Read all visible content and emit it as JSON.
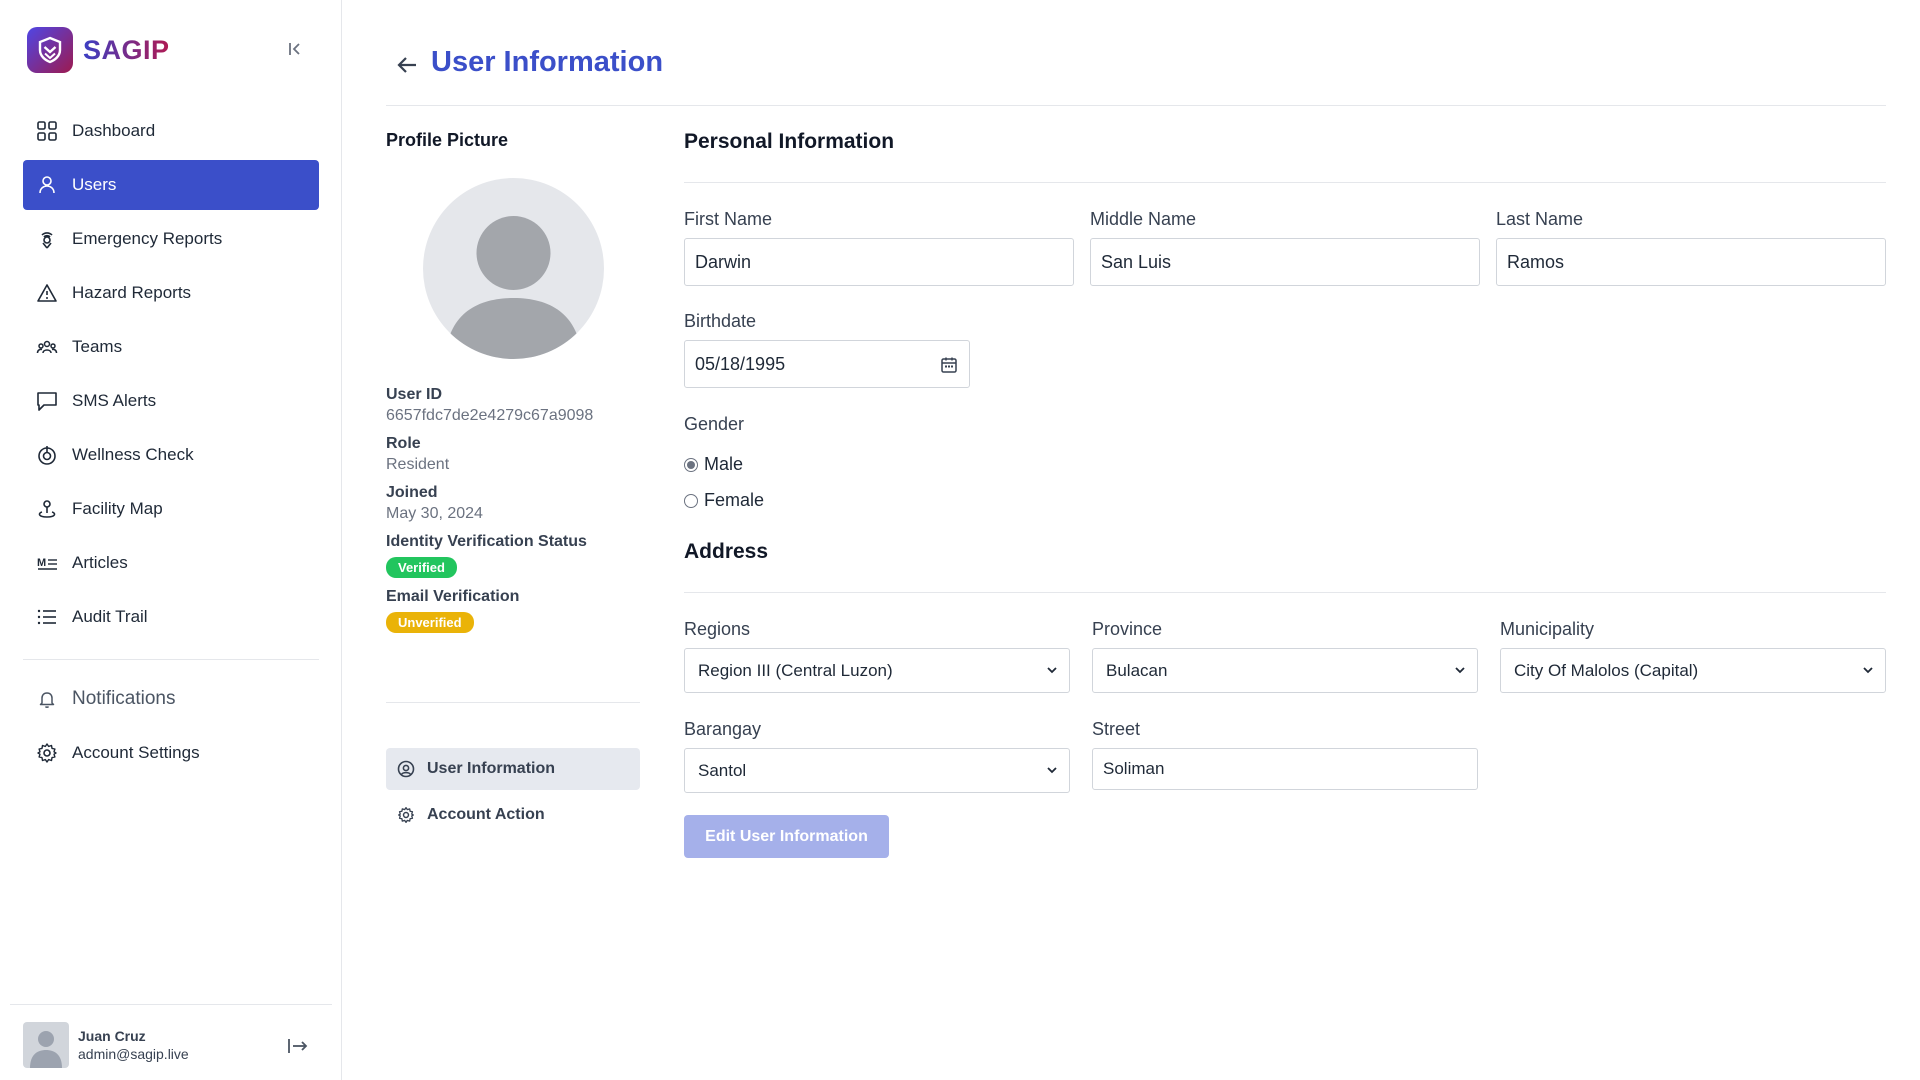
{
  "brand": {
    "name": "SAGIP"
  },
  "sidebar": {
    "items": [
      {
        "label": "Dashboard",
        "icon": "grid-icon"
      },
      {
        "label": "Users",
        "icon": "user-icon",
        "active": true
      },
      {
        "label": "Emergency Reports",
        "icon": "location-alert-icon"
      },
      {
        "label": "Hazard Reports",
        "icon": "warning-triangle-icon"
      },
      {
        "label": "Teams",
        "icon": "team-icon"
      },
      {
        "label": "SMS Alerts",
        "icon": "chat-bubble-icon"
      },
      {
        "label": "Wellness Check",
        "icon": "heartbeat-icon"
      },
      {
        "label": "Facility Map",
        "icon": "map-pin-icon"
      },
      {
        "label": "Articles",
        "icon": "markdown-icon"
      },
      {
        "label": "Audit Trail",
        "icon": "list-icon"
      }
    ],
    "secondary": [
      {
        "label": "Notifications",
        "icon": "bell-icon"
      },
      {
        "label": "Account Settings",
        "icon": "gear-icon"
      }
    ],
    "user": {
      "name": "Juan Cruz",
      "email": "admin@sagip.live"
    }
  },
  "page": {
    "title": "User Information"
  },
  "profile": {
    "picture_label": "Profile Picture",
    "user_id_label": "User ID",
    "user_id": "6657fdc7de2e4279c67a9098",
    "role_label": "Role",
    "role": "Resident",
    "joined_label": "Joined",
    "joined": "May 30, 2024",
    "identity_label": "Identity Verification Status",
    "identity_status": "Verified",
    "email_label": "Email Verification",
    "email_status": "Unverified",
    "tabs": [
      {
        "label": "User Information",
        "active": true
      },
      {
        "label": "Account Action"
      }
    ]
  },
  "personal": {
    "section_title": "Personal Information",
    "first_name_label": "First Name",
    "first_name": "Darwin",
    "middle_name_label": "Middle Name",
    "middle_name": "San Luis",
    "last_name_label": "Last Name",
    "last_name": "Ramos",
    "birthdate_label": "Birthdate",
    "birthdate": "05/18/1995",
    "gender_label": "Gender",
    "gender_options": [
      "Male",
      "Female"
    ],
    "gender_selected": "Male"
  },
  "address": {
    "section_title": "Address",
    "regions_label": "Regions",
    "region": "Region III (Central Luzon)",
    "province_label": "Province",
    "province": "Bulacan",
    "municipality_label": "Municipality",
    "municipality": "City Of Malolos (Capital)",
    "barangay_label": "Barangay",
    "barangay": "Santol",
    "street_label": "Street",
    "street": "Soliman"
  },
  "actions": {
    "edit_label": "Edit User Information"
  },
  "colors": {
    "accent": "#3b4fc9",
    "verified": "#22c55e",
    "unverified": "#eab308",
    "edit_button": "#a5b0ea"
  }
}
